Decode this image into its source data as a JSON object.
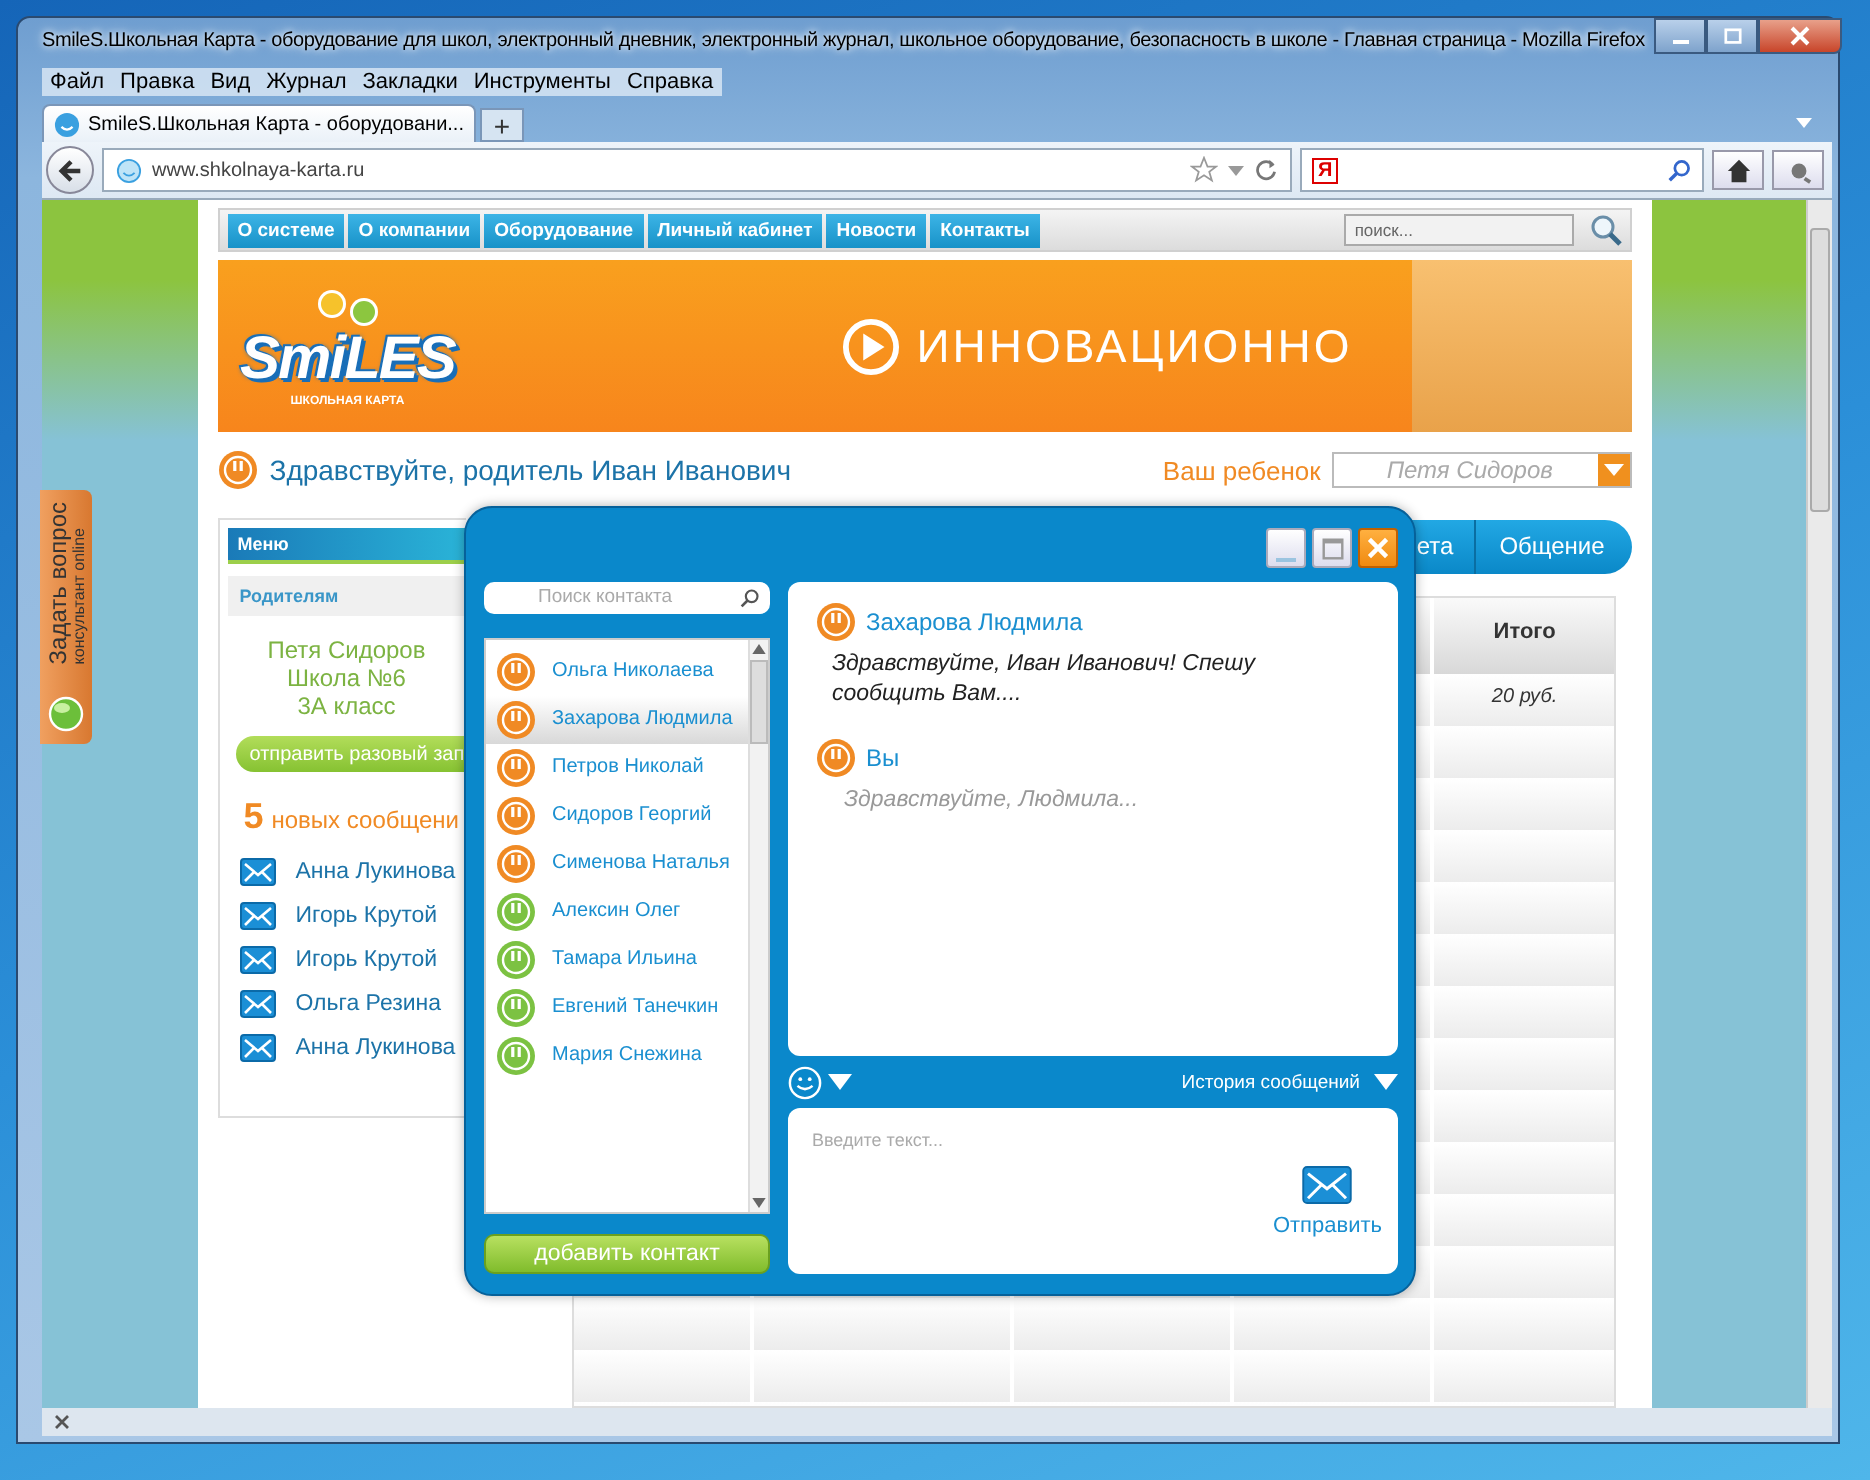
{
  "window": {
    "title": "SmileS.Школьная Карта - оборудование для школ, электронный дневник, электронный журнал, школьное оборудование, безопасность в школе - Главная страница - Mozilla Firefox"
  },
  "menu_bar": [
    "Файл",
    "Правка",
    "Вид",
    "Журнал",
    "Закладки",
    "Инструменты",
    "Справка"
  ],
  "browser_tabs": [
    {
      "label": "SmileS.Школьная Карта - оборудовани...",
      "selected": true
    }
  ],
  "new_tab_button": "+",
  "address_bar": {
    "url": "www.shkolnaya-karta.ru"
  },
  "search_bar": {
    "engine_logo": "Я"
  },
  "site_nav": [
    "О системе",
    "О компании",
    "Оборудование",
    "Личный кабинет",
    "Новости",
    "Контакты"
  ],
  "site_search": {
    "placeholder": "поиск..."
  },
  "banner": {
    "logo": "SmiLES",
    "logo_subtitle": "ШКОЛЬНАЯ КАРТА",
    "slogan": "ИННОВАЦИОННО"
  },
  "greeting": "Здравствуйте, родитель Иван Иванович",
  "child_selector": {
    "label": "Ваш ребенок",
    "value": "Петя Сидоров"
  },
  "side_tab": {
    "title": "Задать вопрос",
    "subtitle": "консультант online"
  },
  "left_menu": {
    "title": "Меню",
    "section": "Родителям",
    "child_info": [
      "Петя Сидоров",
      "Школа №6",
      "3А класс"
    ],
    "request_button": "отправить разовый зап",
    "new_count": "5",
    "new_label": "новых сообщени",
    "messages": [
      "Анна Лукинова",
      "Игорь Крутой",
      "Игорь Крутой",
      "Ольга Резина",
      "Анна Лукинова"
    ]
  },
  "page_tabs": [
    "ета",
    "Общение"
  ],
  "table": {
    "last_column": "Итого",
    "rows": [
      {
        "total": "20 руб."
      }
    ]
  },
  "chat": {
    "contact_search": {
      "placeholder": "Поиск контакта"
    },
    "contacts": [
      {
        "name": "Ольга Николаева",
        "color": "#f08a24",
        "selected": false
      },
      {
        "name": "Захарова Людмила",
        "color": "#f08a24",
        "selected": true
      },
      {
        "name": "Петров Николай",
        "color": "#f08a24",
        "selected": false
      },
      {
        "name": "Сидоров Георгий",
        "color": "#f08a24",
        "selected": false
      },
      {
        "name": "Сименова Наталья",
        "color": "#f08a24",
        "selected": false
      },
      {
        "name": "Алексин Олег",
        "color": "#7cc242",
        "selected": false
      },
      {
        "name": "Тамара Ильина",
        "color": "#7cc242",
        "selected": false
      },
      {
        "name": "Евгений Танечкин",
        "color": "#7cc242",
        "selected": false
      },
      {
        "name": "Мария Снежина",
        "color": "#7cc242",
        "selected": false
      }
    ],
    "add_contact_button": "добавить контакт",
    "messages": [
      {
        "author": "Захарова Людмила",
        "text": "Здравствуйте, Иван Иванович! Спешу сообщить Вам....",
        "kind": "incoming"
      },
      {
        "author": "Вы",
        "text": "Здравствуйте, Людмила...",
        "kind": "draft"
      }
    ],
    "history_label": "История сообщений",
    "input": {
      "placeholder": "Введите текст..."
    },
    "send_button": "Отправить"
  }
}
